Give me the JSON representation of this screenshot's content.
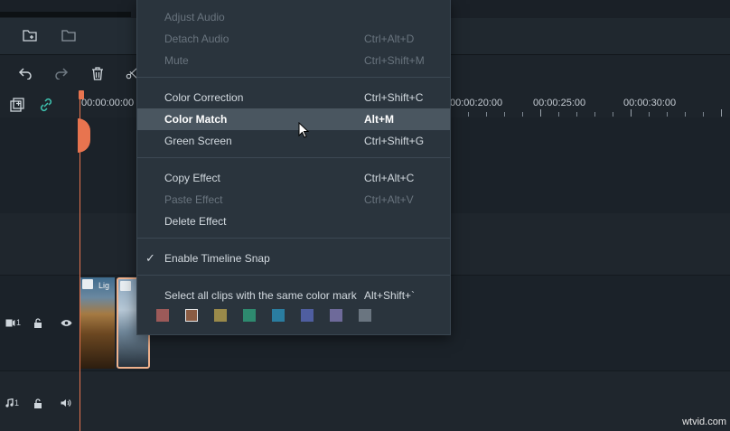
{
  "menu": {
    "items": [
      {
        "label": "Adjust Audio",
        "shortcut": ""
      },
      {
        "label": "Detach Audio",
        "shortcut": "Ctrl+Alt+D"
      },
      {
        "label": "Mute",
        "shortcut": "Ctrl+Shift+M"
      },
      {
        "label": "Color Correction",
        "shortcut": "Ctrl+Shift+C"
      },
      {
        "label": "Color Match",
        "shortcut": "Alt+M"
      },
      {
        "label": "Green Screen",
        "shortcut": "Ctrl+Shift+G"
      },
      {
        "label": "Copy Effect",
        "shortcut": "Ctrl+Alt+C"
      },
      {
        "label": "Paste Effect",
        "shortcut": "Ctrl+Alt+V"
      },
      {
        "label": "Delete Effect",
        "shortcut": ""
      },
      {
        "label": "Enable Timeline Snap",
        "shortcut": ""
      },
      {
        "label": "Select all clips with the same color mark",
        "shortcut": "Alt+Shift+`"
      }
    ],
    "checkmark": "✓",
    "color_marks": [
      "#9c5a59",
      "#8a5c43",
      "#9a8a4a",
      "#2e8a6f",
      "#2a7da0",
      "#4f5ea0",
      "#6e6a9a",
      "#6a7580"
    ]
  },
  "ruler": {
    "labels": [
      "00:00:00:00",
      "00:00:20:00",
      "00:00:25:00",
      "00:00:30:00"
    ]
  },
  "tracks": {
    "video": {
      "label": "1"
    },
    "audio": {
      "label": "1"
    }
  },
  "clips": [
    {
      "title": "Lig"
    }
  ],
  "watermark": "wtvid.com",
  "icons": [
    "add-folder-icon",
    "folder-icon",
    "undo-icon",
    "redo-icon",
    "trash-icon",
    "scissors-icon",
    "add-track-icon",
    "link-icon",
    "video-track-icon",
    "lock-icon",
    "eye-icon",
    "music-icon",
    "speaker-icon"
  ]
}
